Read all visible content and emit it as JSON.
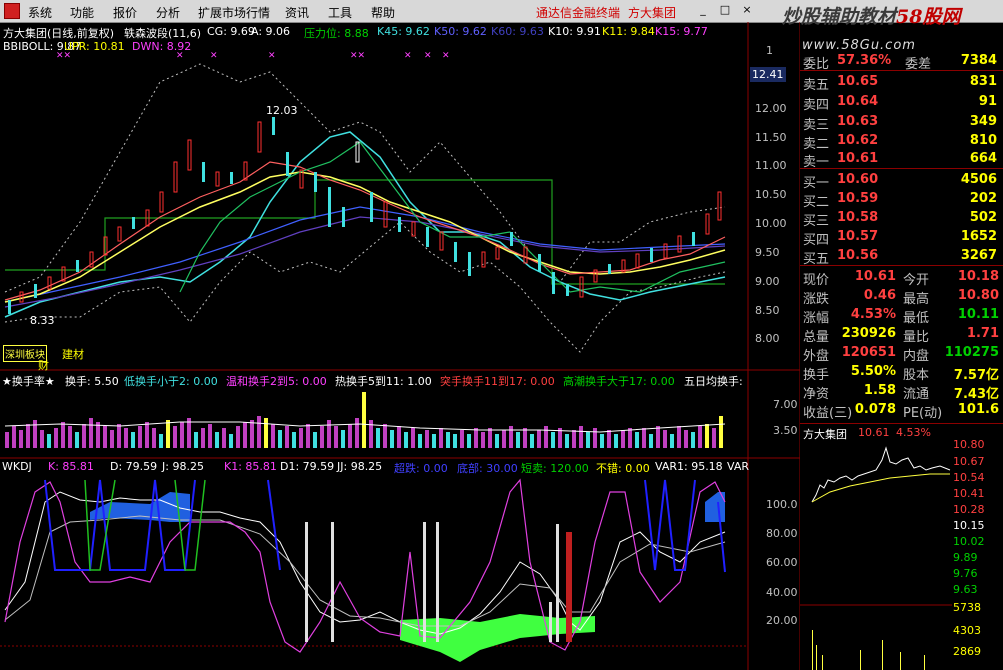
{
  "menu": {
    "items": [
      "系统",
      "功能",
      "报价",
      "分析",
      "扩展市场行情",
      "资讯",
      "工具",
      "帮助"
    ],
    "links": [
      "通达信金融终端",
      "方大集团"
    ],
    "window_buttons": [
      "_",
      "□",
      "×"
    ]
  },
  "watermark": {
    "text_cn": "炒股辅助教材",
    "brand": "58股网",
    "site": "www.58Gu.com"
  },
  "main_header": {
    "title": "方大集团(日线,前复权)",
    "indicator": "轶森波段(11,6)",
    "cg": "CG: 9.69",
    "a": "A: 9.06",
    "pressure": "压力位: 8.88",
    "k45": "K45: 9.62",
    "k50": "K50: 9.62",
    "k60": "K60: 9.63",
    "k10": "K10: 9.91",
    "k11": "K11: 9.84",
    "k15": "K15: 9.77"
  },
  "boll": {
    "bbiboll": "BBIBOLL: 9.87",
    "upr": "UPR: 10.81",
    "dwn": "DWN: 8.92"
  },
  "price_axis": [
    "12.41",
    "12.00",
    "11.50",
    "11.00",
    "10.50",
    "10.00",
    "9.50",
    "9.00",
    "8.50",
    "8.00"
  ],
  "price_labels": {
    "high": "12.03",
    "low": "8.33"
  },
  "sector_tags": {
    "tag1": "深圳板块",
    "tag2": "建材",
    "tag3": "财"
  },
  "turnover_header": {
    "name": "★换手率★",
    "v1": "换手: 5.50",
    "v2": "低换手小于2: 0.00",
    "v3": "温和换手2到5: 0.00",
    "v4": "热换手5到11: 1.00",
    "v5": "突手换手11到17: 0.00",
    "v6": "高潮换手大于17: 0.00",
    "v7": "五日均换手:"
  },
  "turnover_axis": [
    "7.00",
    "3.50"
  ],
  "kdj_header": {
    "name": "WKDJ",
    "k": "K: 85.81",
    "d": "D: 79.59",
    "j": "J: 98.25",
    "k1": "K1: 85.81",
    "d1": "D1: 79.59",
    "jj": "JJ: 98.25",
    "x1": "超跌: 0.00",
    "x2": "底部: 30.00",
    "short": "短卖: 120.00",
    "x3": "不错: 0.00",
    "var1": "VAR1: 95.18",
    "var": "VAR"
  },
  "kdj_axis": [
    "100.0",
    "80.00",
    "60.00",
    "40.00",
    "20.00"
  ],
  "quote": {
    "weibi_label": "委比",
    "weibi_value": "57.36%",
    "weicha_label": "委差",
    "weicha_value": "7384",
    "asks": [
      {
        "label": "卖五",
        "price": "10.65",
        "vol": "831"
      },
      {
        "label": "卖四",
        "price": "10.64",
        "vol": "91"
      },
      {
        "label": "卖三",
        "price": "10.63",
        "vol": "349"
      },
      {
        "label": "卖二",
        "price": "10.62",
        "vol": "810"
      },
      {
        "label": "卖一",
        "price": "10.61",
        "vol": "664"
      }
    ],
    "bids": [
      {
        "label": "买一",
        "price": "10.60",
        "vol": "4506"
      },
      {
        "label": "买二",
        "price": "10.59",
        "vol": "202"
      },
      {
        "label": "买三",
        "price": "10.58",
        "vol": "502"
      },
      {
        "label": "买四",
        "price": "10.57",
        "vol": "1652"
      },
      {
        "label": "买五",
        "price": "10.56",
        "vol": "3267"
      }
    ]
  },
  "stats": [
    {
      "l1": "现价",
      "v1": "10.61",
      "c1": "red",
      "l2": "今开",
      "v2": "10.18",
      "c2": "red"
    },
    {
      "l1": "涨跌",
      "v1": "0.46",
      "c1": "red",
      "l2": "最高",
      "v2": "10.80",
      "c2": "red"
    },
    {
      "l1": "涨幅",
      "v1": "4.53%",
      "c1": "red",
      "l2": "最低",
      "v2": "10.11",
      "c2": "green"
    },
    {
      "l1": "总量",
      "v1": "230926",
      "c1": "yellow",
      "l2": "量比",
      "v2": "1.71",
      "c2": "red"
    },
    {
      "l1": "外盘",
      "v1": "120651",
      "c1": "red",
      "l2": "内盘",
      "v2": "110275",
      "c2": "green"
    },
    {
      "l1": "换手",
      "v1": "5.50%",
      "c1": "yellow",
      "l2": "股本",
      "v2": "7.57亿",
      "c2": "yellow"
    },
    {
      "l1": "净资",
      "v1": "1.58",
      "c1": "yellow",
      "l2": "流通",
      "v2": "7.43亿",
      "c2": "yellow"
    },
    {
      "l1": "收益(三)",
      "v1": "0.078",
      "c1": "yellow",
      "l2": "PE(动)",
      "v2": "101.6",
      "c2": "yellow"
    }
  ],
  "mini": {
    "name": "方大集团",
    "price": "10.61",
    "pct": "4.53%",
    "axis": [
      "10.80",
      "10.67",
      "10.54",
      "10.41",
      "10.28",
      "10.15",
      "10.02",
      "9.89",
      "9.76",
      "9.63"
    ],
    "vol_axis": [
      "5738",
      "4303",
      "2869"
    ]
  },
  "colors": {
    "up": "#ff3030",
    "down": "#40e0e0",
    "bg": "#000000",
    "grid": "#8b0000"
  }
}
